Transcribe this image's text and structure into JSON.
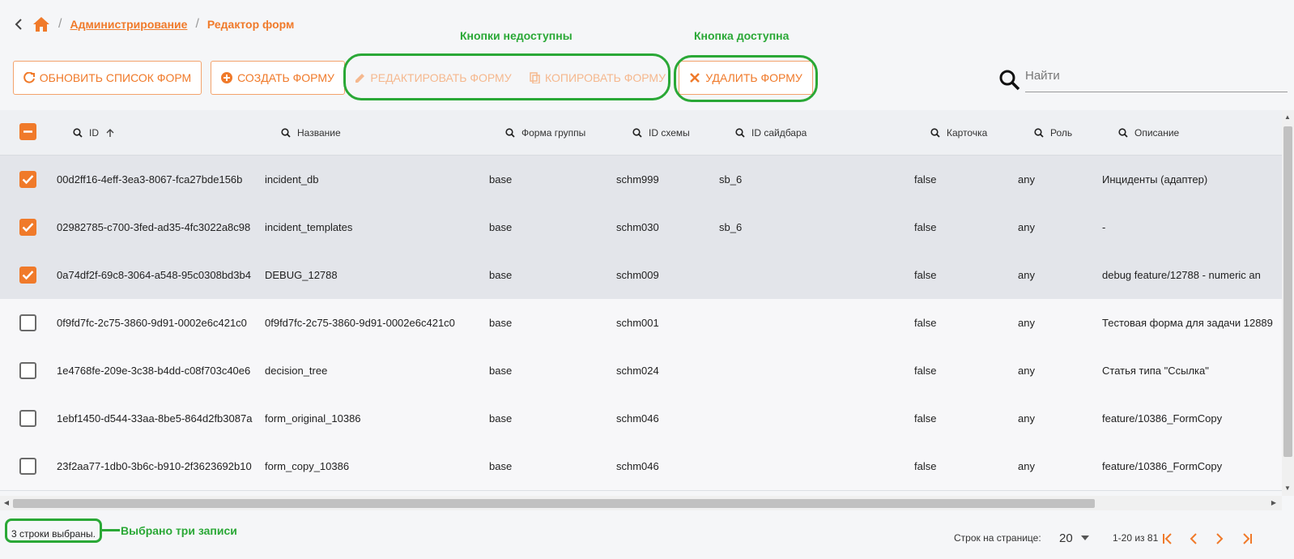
{
  "breadcrumb": {
    "home_icon": "home-icon",
    "items": [
      "Администрирование",
      "Редактор форм"
    ]
  },
  "annotations": {
    "buttons_unavailable": "Кнопки недоступны",
    "button_available": "Кнопка доступна",
    "three_selected": "Выбрано три записи"
  },
  "toolbar": {
    "refresh_label": "ОБНОВИТЬ СПИСОК ФОРМ",
    "create_label": "СОЗДАТЬ ФОРМУ",
    "edit_label": "РЕДАКТИРОВАТЬ ФОРМУ",
    "copy_label": "КОПИРОВАТЬ ФОРМУ",
    "delete_label": "УДАЛИТЬ ФОРМУ"
  },
  "search": {
    "placeholder": "Найти",
    "value": ""
  },
  "columns": [
    "ID",
    "Название",
    "Форма группы",
    "ID схемы",
    "ID сайдбара",
    "Карточка",
    "Роль",
    "Описание"
  ],
  "rows": [
    {
      "selected": true,
      "id": "00d2ff16-4eff-3ea3-8067-fca27bde156b",
      "name": "incident_db",
      "group": "base",
      "schema": "schm999",
      "sidebar": "sb_6",
      "card": "false",
      "role": "any",
      "desc": "Инциденты (адаптер)"
    },
    {
      "selected": true,
      "id": "02982785-c700-3fed-ad35-4fc3022a8c98",
      "name": "incident_templates",
      "group": "base",
      "schema": "schm030",
      "sidebar": "sb_6",
      "card": "false",
      "role": "any",
      "desc": "-"
    },
    {
      "selected": true,
      "id": "0a74df2f-69c8-3064-a548-95c0308bd3b4",
      "name": "DEBUG_12788",
      "group": "base",
      "schema": "schm009",
      "sidebar": "",
      "card": "false",
      "role": "any",
      "desc": "debug feature/12788 - numeric an"
    },
    {
      "selected": false,
      "id": "0f9fd7fc-2c75-3860-9d91-0002e6c421c0",
      "name": "0f9fd7fc-2c75-3860-9d91-0002e6c421c0",
      "group": "base",
      "schema": "schm001",
      "sidebar": "",
      "card": "false",
      "role": "any",
      "desc": "Тестовая форма для задачи 12889"
    },
    {
      "selected": false,
      "id": "1e4768fe-209e-3c38-b4dd-c08f703c40e6",
      "name": "decision_tree",
      "group": "base",
      "schema": "schm024",
      "sidebar": "",
      "card": "false",
      "role": "any",
      "desc": "Статья типа \"Ссылка\""
    },
    {
      "selected": false,
      "id": "1ebf1450-d544-33aa-8be5-864d2fb3087a",
      "name": "form_original_10386",
      "group": "base",
      "schema": "schm046",
      "sidebar": "",
      "card": "false",
      "role": "any",
      "desc": "feature/10386_FormCopy"
    },
    {
      "selected": false,
      "id": "23f2aa77-1db0-3b6c-b910-2f3623692b10",
      "name": "form_copy_10386",
      "group": "base",
      "schema": "schm046",
      "sidebar": "",
      "card": "false",
      "role": "any",
      "desc": "feature/10386_FormCopy"
    }
  ],
  "footer": {
    "selection_text": "3 строки выбраны.",
    "rows_per_page_label": "Строк на странице:",
    "rows_per_page": "20",
    "range": "1-20 из 81"
  },
  "colors": {
    "accent": "#f07a2a",
    "annotation": "#2aa836"
  }
}
